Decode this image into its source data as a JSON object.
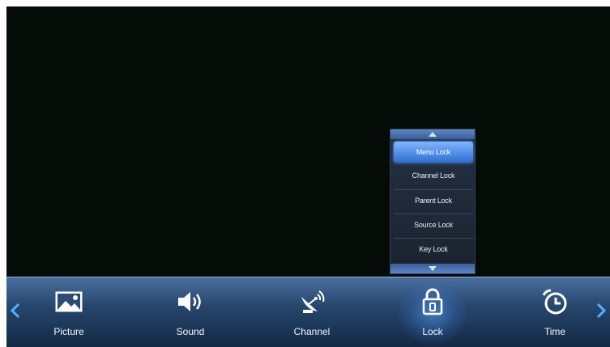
{
  "submenu": {
    "items": [
      {
        "label": "Menu Lock",
        "selected": true
      },
      {
        "label": "Channel Lock",
        "selected": false
      },
      {
        "label": "Parent Lock",
        "selected": false
      },
      {
        "label": "Source Lock",
        "selected": false
      },
      {
        "label": "Key Lock",
        "selected": false
      }
    ]
  },
  "menubar": {
    "items": [
      {
        "label": "Picture",
        "icon": "picture-icon"
      },
      {
        "label": "Sound",
        "icon": "speaker-icon"
      },
      {
        "label": "Channel",
        "icon": "satellite-dish-icon"
      },
      {
        "label": "Lock",
        "icon": "padlock-icon",
        "selected": true
      },
      {
        "label": "Time",
        "icon": "alarm-clock-icon"
      }
    ]
  },
  "colors": {
    "accent": "#4fb0ff",
    "selected_item": "#3f82e0",
    "bar_top": "#4a6f9f",
    "bar_bottom": "#132944"
  }
}
